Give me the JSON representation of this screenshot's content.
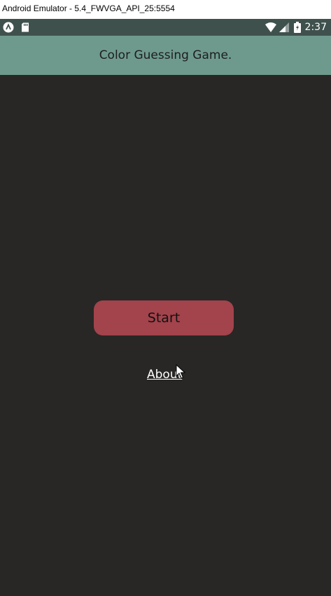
{
  "window": {
    "title": "Android Emulator - 5.4_FWVGA_API_25:5554"
  },
  "status_bar": {
    "left_icons": [
      "launcher-icon",
      "sd-card-icon"
    ],
    "right_icons": [
      "wifi-icon",
      "signal-icon",
      "battery-charging-icon"
    ],
    "time": "2:37"
  },
  "app_bar": {
    "title": "Color Guessing Game."
  },
  "main": {
    "start_label": "Start",
    "about_label": "About"
  },
  "colors": {
    "status_bar": "#3f514d",
    "app_bar": "#6e9a8d",
    "background": "#282725",
    "start_button": "#a3434c",
    "about_link": "#ffffff"
  }
}
